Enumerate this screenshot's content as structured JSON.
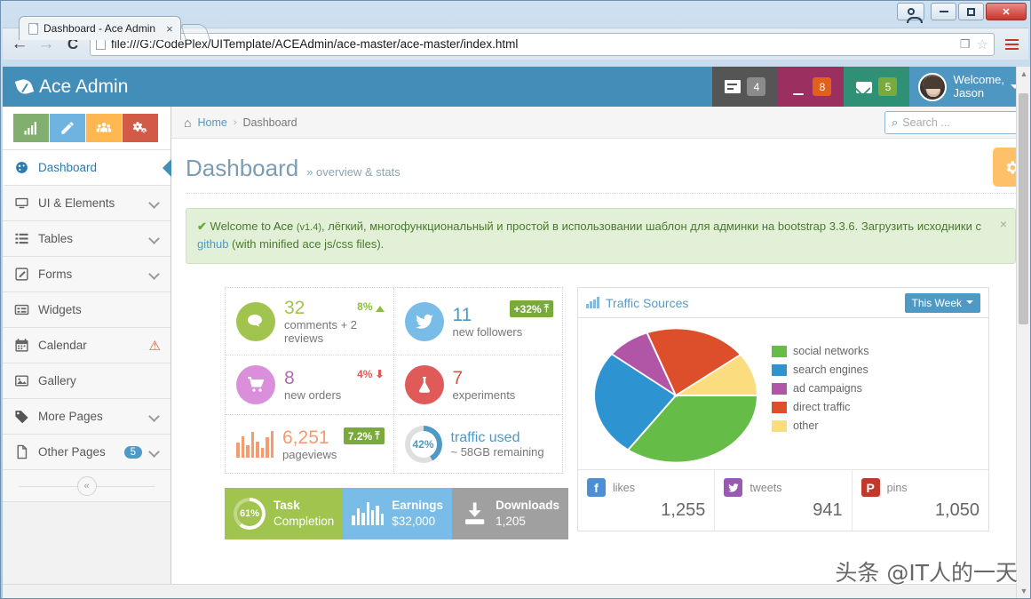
{
  "browser": {
    "tab_title": "Dashboard - Ace Admin",
    "tab_close": "×",
    "url": "file:///G:/CodePlex/UITemplate/ACEAdmin/ace-master/ace-master/index.html",
    "back_icon": "←",
    "forward_icon": "→",
    "reload_icon": "C",
    "translate_icon": "❐",
    "star_icon": "☆",
    "minimize_label": "–",
    "maximize_label": "□",
    "close_label": "✕"
  },
  "navbar": {
    "brand": "Ace Admin",
    "tasks_badge": "4",
    "notifications_badge": "8",
    "messages_badge": "5",
    "welcome_line1": "Welcome,",
    "welcome_line2": "Jason"
  },
  "sidebar": {
    "shortcuts": [
      {
        "name": "chart-shortcut",
        "color": "#82af6f"
      },
      {
        "name": "edit-shortcut",
        "color": "#6fb3e0"
      },
      {
        "name": "users-shortcut",
        "color": "#ffb752"
      },
      {
        "name": "settings-shortcut",
        "color": "#d15b47"
      }
    ],
    "items": [
      {
        "label": "Dashboard",
        "icon": "dashboard-icon",
        "active": true,
        "chevron": false,
        "badge": null,
        "warn": false
      },
      {
        "label": "UI & Elements",
        "icon": "monitor-icon",
        "active": false,
        "chevron": true,
        "badge": null,
        "warn": false
      },
      {
        "label": "Tables",
        "icon": "list-icon",
        "active": false,
        "chevron": true,
        "badge": null,
        "warn": false
      },
      {
        "label": "Forms",
        "icon": "form-icon",
        "active": false,
        "chevron": true,
        "badge": null,
        "warn": false
      },
      {
        "label": "Widgets",
        "icon": "widget-icon",
        "active": false,
        "chevron": false,
        "badge": null,
        "warn": false
      },
      {
        "label": "Calendar",
        "icon": "calendar-icon",
        "active": false,
        "chevron": false,
        "badge": null,
        "warn": true
      },
      {
        "label": "Gallery",
        "icon": "image-icon",
        "active": false,
        "chevron": false,
        "badge": null,
        "warn": false
      },
      {
        "label": "More Pages",
        "icon": "tag-icon",
        "active": false,
        "chevron": true,
        "badge": null,
        "warn": false
      },
      {
        "label": "Other Pages",
        "icon": "file-icon",
        "active": false,
        "chevron": true,
        "badge": "5",
        "warn": false
      }
    ],
    "collapse_icon": "«",
    "warn_icon": "⚠"
  },
  "breadcrumb": {
    "home_icon": "⌂",
    "home": "Home",
    "separator": "›",
    "current": "Dashboard"
  },
  "search": {
    "placeholder": "Search ...",
    "value": "",
    "icon": "⌕"
  },
  "page": {
    "title": "Dashboard",
    "subtitle": "» overview & stats",
    "settings_icon": "gear-icon"
  },
  "alert": {
    "check": "✔",
    "prefix": "Welcome to",
    "brand": "Ace",
    "version": "(v1.4)",
    "text_ru": ", лёгкий, многофункциональный и простой в использовании шаблон для админки на bootstrap 3.3.6. Загрузить исходники с",
    "link": "github",
    "suffix": "(with minified ace js/css files).",
    "close": "×"
  },
  "infoboxes": [
    {
      "name": "comments",
      "icon": "comment-icon",
      "color": "c-green",
      "num": "32",
      "num_class": "n-green",
      "text": "comments + 2 reviews",
      "trend": "8%",
      "trend_dir": "up",
      "trend_style": "plain"
    },
    {
      "name": "followers",
      "icon": "twitter-icon",
      "color": "c-blue",
      "num": "11",
      "num_class": "n-blue",
      "text": "new followers",
      "trend": "+32%",
      "trend_dir": "up",
      "trend_style": "badge"
    },
    {
      "name": "orders",
      "icon": "cart-icon",
      "color": "c-purple",
      "num": "8",
      "num_class": "n-purple",
      "text": "new orders",
      "trend": "4%",
      "trend_dir": "down",
      "trend_style": "plain"
    },
    {
      "name": "experiments",
      "icon": "flask-icon",
      "color": "c-red",
      "num": "7",
      "num_class": "n-red",
      "text": "experiments",
      "trend": "",
      "trend_dir": "",
      "trend_style": "none"
    },
    {
      "name": "pageviews",
      "icon": "bars-icon",
      "color": "",
      "num": "6,251",
      "num_class": "n-orange",
      "text": "pageviews",
      "trend": "7.2%",
      "trend_dir": "up",
      "trend_style": "badge"
    },
    {
      "name": "traffic-used",
      "icon": "donut-icon",
      "color": "",
      "num": "traffic used",
      "num_class": "n-blue",
      "text": "~ 58GB remaining",
      "trend": "",
      "trend_dir": "",
      "trend_style": "none",
      "donut_value": "42%"
    }
  ],
  "tiles": [
    {
      "name": "task-completion",
      "style": "green",
      "icon": "ring-icon",
      "ring_value": "61%",
      "line1": "Task",
      "line2": "Completion"
    },
    {
      "name": "earnings",
      "style": "blue",
      "icon": "bars-icon",
      "line1": "Earnings",
      "line2": "$32,000"
    },
    {
      "name": "downloads",
      "style": "grey",
      "icon": "download-icon",
      "line1": "Downloads",
      "line2": "1,205"
    }
  ],
  "traffic_panel": {
    "title": "Traffic Sources",
    "dropdown": "This Week",
    "social": [
      {
        "name": "likes",
        "icon": "facebook-icon",
        "sq": "sq-fb",
        "glyph": "f",
        "label": "likes",
        "value": "1,255"
      },
      {
        "name": "tweets",
        "icon": "twitter-icon",
        "sq": "sq-tw",
        "glyph": "ᴠ",
        "label": "tweets",
        "value": "941"
      },
      {
        "name": "pins",
        "icon": "pinterest-icon",
        "sq": "sq-pi",
        "glyph": "P",
        "label": "pins",
        "value": "1,050"
      }
    ]
  },
  "chart_data": {
    "type": "pie",
    "title": "Traffic Sources",
    "period": "This Week",
    "legend_position": "right",
    "labels": [
      "social networks",
      "search engines",
      "ad campaigns",
      "direct traffic",
      "other"
    ],
    "values": [
      38,
      25,
      8,
      17,
      12
    ],
    "colors": [
      "#65bd47",
      "#2e93d1",
      "#b155a6",
      "#dd4f2b",
      "#fbdc7f"
    ]
  },
  "watermark": "头条 @IT人的一天"
}
